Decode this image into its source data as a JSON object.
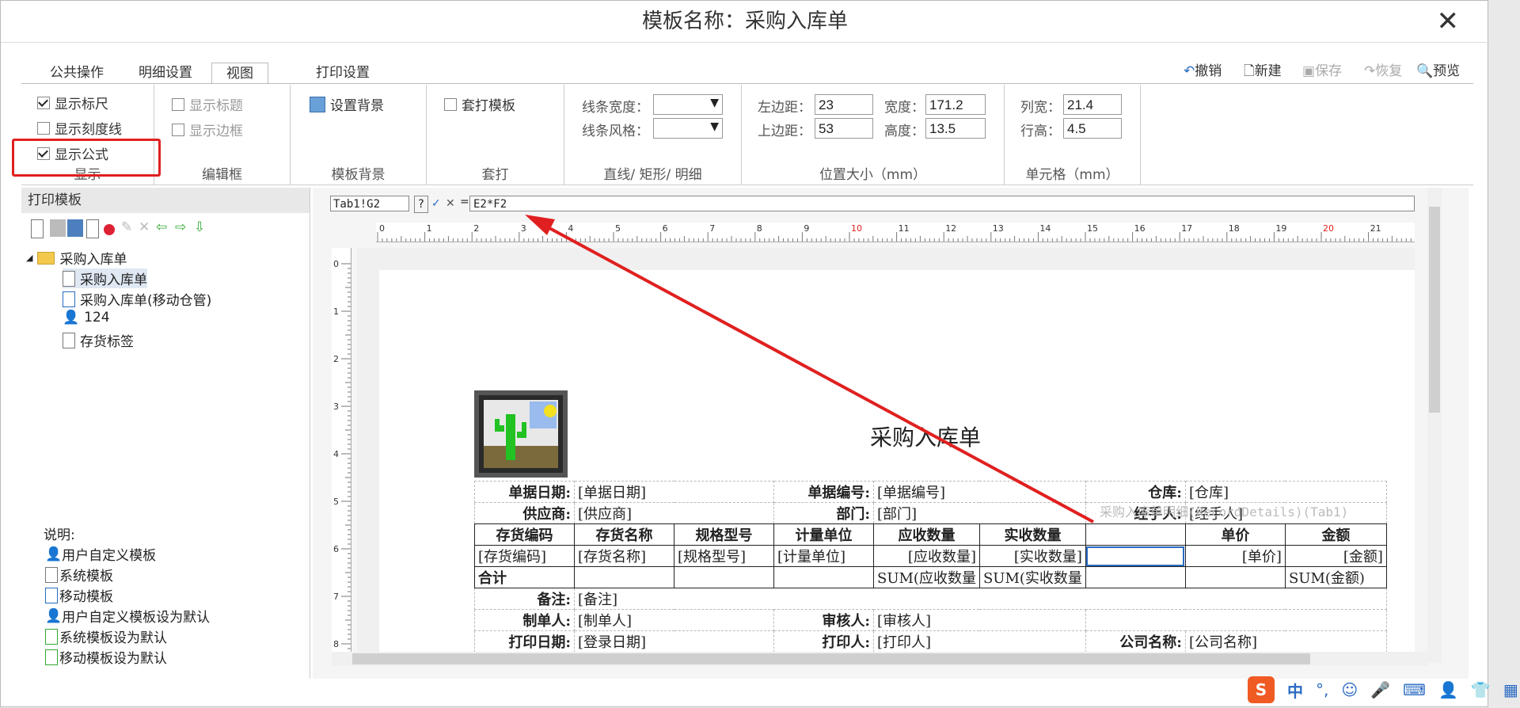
{
  "window": {
    "title": "模板名称：采购入库单",
    "close": "✕"
  },
  "tabs": [
    {
      "label": "公共操作"
    },
    {
      "label": "明细设置"
    },
    {
      "label": "视图"
    },
    {
      "label": "打印设置"
    }
  ],
  "toolbar": {
    "undo": "撤销",
    "new": "新建",
    "save": "保存",
    "restore": "恢复",
    "preview": "预览"
  },
  "ribbon": {
    "display": {
      "group": "显示",
      "show_ruler": "显示标尺",
      "show_scale": "显示刻度线",
      "show_formula": "显示公式"
    },
    "edit_box": {
      "group": "编辑框",
      "show_title": "显示标题",
      "show_border": "显示边框"
    },
    "background": {
      "group": "模板背景",
      "set_bg": "设置背景"
    },
    "overlay": {
      "group": "套打",
      "overlay_tpl": "套打模板"
    },
    "lines": {
      "group": "直线/ 矩形/ 明细",
      "width_label": "线条宽度：",
      "style_label": "线条风格："
    },
    "position": {
      "group": "位置大小（mm）",
      "left_label": "左边距：",
      "left": "23",
      "width_label": "宽度：",
      "width": "171.2",
      "top_label": "上边距：",
      "top": "53",
      "height_label": "高度：",
      "height": "13.5"
    },
    "cell": {
      "group": "单元格（mm）",
      "colw_label": "列宽：",
      "colw": "21.4",
      "rowh_label": "行高：",
      "rowh": "4.5"
    }
  },
  "left_pane": {
    "header": "打印模板",
    "tree": [
      {
        "label": "采购入库单"
      },
      {
        "label": "采购入库单"
      },
      {
        "label": "采购入库单(移动仓管)"
      },
      {
        "label": "124"
      },
      {
        "label": "存货标签"
      }
    ],
    "legend_title": "说明:",
    "legend": [
      {
        "label": "用户自定义模板"
      },
      {
        "label": "系统模板"
      },
      {
        "label": "移动模板"
      },
      {
        "label": "用户自定义模板设为默认"
      },
      {
        "label": "系统模板设为默认"
      },
      {
        "label": "移动模板设为默认"
      }
    ]
  },
  "formula_bar": {
    "cell_ref": "Tab1!G2",
    "question": "?",
    "equals": "=",
    "formula": "E2*F2"
  },
  "ruler": {
    "h": [
      "0",
      "1",
      "2",
      "3",
      "4",
      "5",
      "6",
      "7",
      "8",
      "9",
      "10",
      "11",
      "12",
      "13",
      "14",
      "15",
      "16",
      "17",
      "18",
      "19",
      "20",
      "21"
    ],
    "v": [
      "0",
      "1",
      "2",
      "3",
      "4",
      "5",
      "6",
      "7",
      "8"
    ],
    "red_marks": [
      "10",
      "20"
    ]
  },
  "doc": {
    "title": "采购入库单",
    "rows": {
      "r1": [
        "单据日期:",
        "[单据日期]",
        "单据编号:",
        "[单据编号]",
        "仓库:",
        "[仓库]"
      ],
      "r2": [
        "供应商:",
        "[供应商]",
        "部门:",
        "[部门]",
        "经手人:",
        "[经手人]"
      ],
      "header": [
        "存货编码",
        "存货名称",
        "规格型号",
        "计量单位",
        "应收数量",
        "实收数量",
        "",
        "单价",
        "金额"
      ],
      "detail": [
        "[存货编码]",
        "[存货名称]",
        "[规格型号]",
        "[计量单位]",
        "[应收数量]",
        "[实收数量]",
        "",
        "[单价]",
        "[金额]"
      ],
      "total": [
        "合计",
        "",
        "",
        "",
        "SUM(应收数量",
        "SUM(实收数量",
        "",
        "",
        "SUM(金额)"
      ],
      "remark": [
        "备注:",
        "[备注]"
      ],
      "maker": [
        "制单人:",
        "[制单人]",
        "审核人:",
        "[审核人]"
      ],
      "print": [
        "打印日期:",
        "[登录日期]",
        "打印人:",
        "[打印人]",
        "公司名称:",
        "[公司名称]"
      ],
      "ghost": "采购入库单明细(RecordDetails)(Tab1)"
    }
  },
  "taskbar": {
    "ime": "中",
    "punct": "°,"
  },
  "colors": {
    "red": "#e02020",
    "accent": "#2a6bc2"
  }
}
